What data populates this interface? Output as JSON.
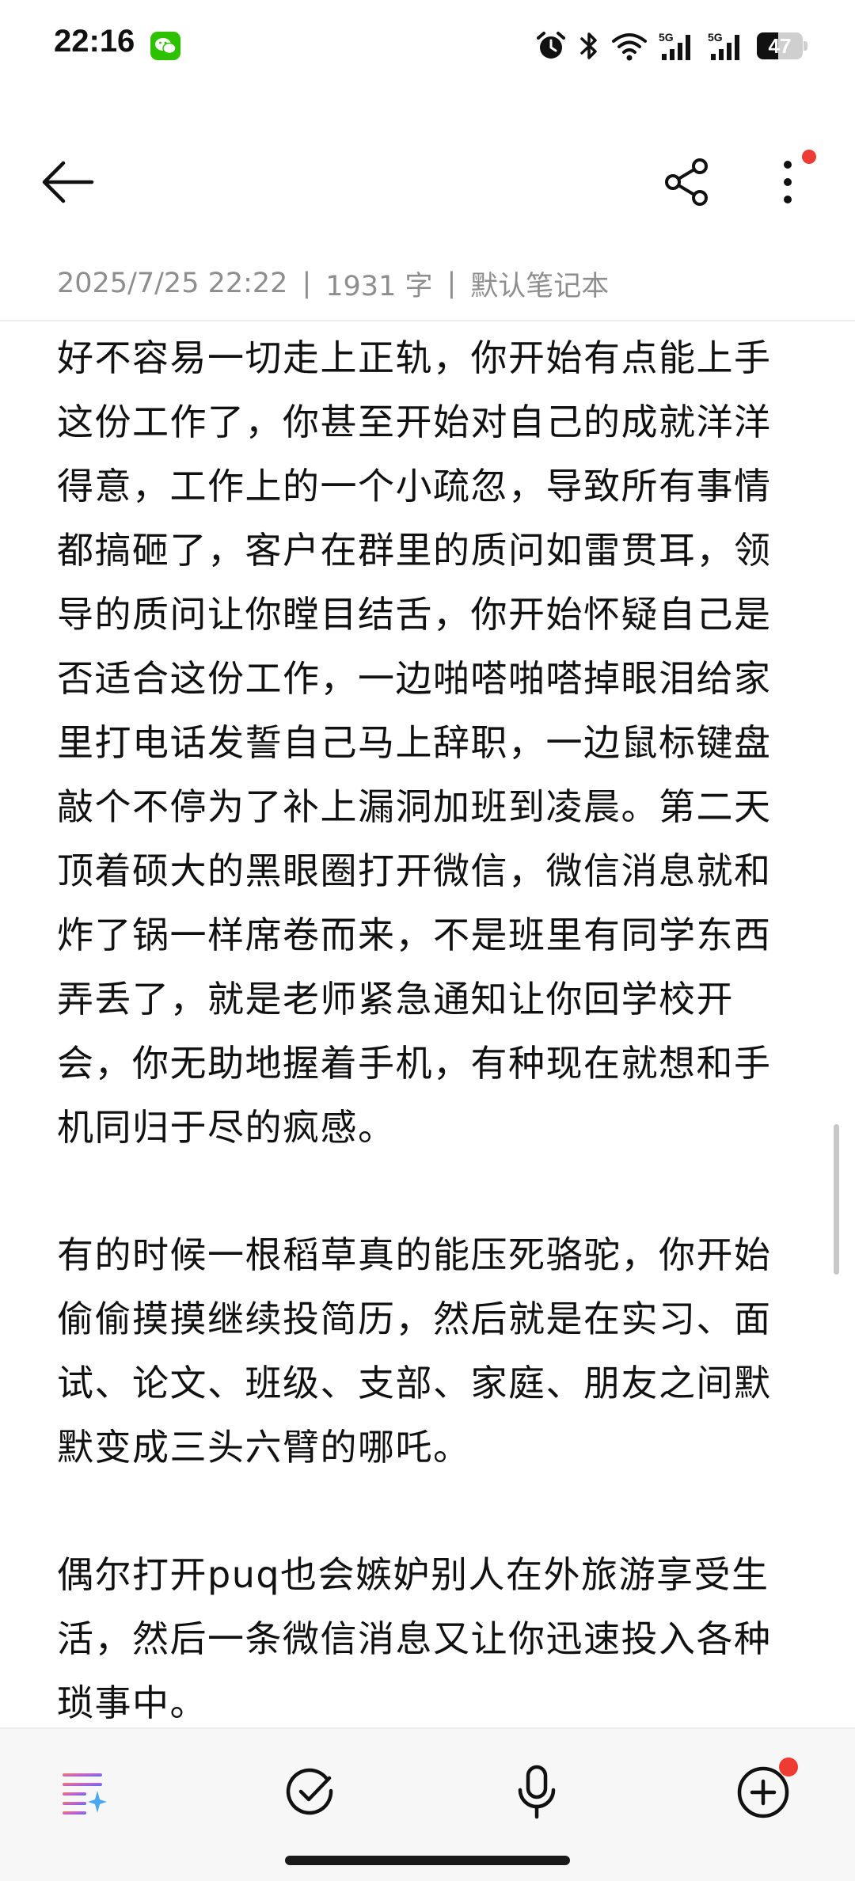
{
  "status_bar": {
    "time": "22:16",
    "battery": "47",
    "battery_level": 0.47,
    "network_label_1": "5G",
    "network_label_2": "5G"
  },
  "toolbar": {
    "back_icon": "arrow-left-icon",
    "share_icon": "share-icon",
    "more_icon": "more-vertical-icon"
  },
  "meta": {
    "date": "2025/7/25 22:22",
    "separator": "|",
    "word_count": "1931 字",
    "notebook": "默认笔记本"
  },
  "note": {
    "paragraphs": [
      "好不容易一切走上正轨，你开始有点能上手这份工作了，你甚至开始对自己的成就洋洋得意，工作上的一个小疏忽，导致所有事情都搞砸了，客户在群里的质问如雷贯耳，领导的质问让你瞠目结舌，你开始怀疑自己是否适合这份工作，一边啪嗒啪嗒掉眼泪给家里打电话发誓自己马上辞职，一边鼠标键盘敲个不停为了补上漏洞加班到凌晨。第二天顶着硕大的黑眼圈打开微信，微信消息就和炸了锅一样席卷而来，不是班里有同学东西弄丢了，就是老师紧急通知让你回学校开会，你无助地握着手机，有种现在就想和手机同归于尽的疯感。",
      "有的时候一根稻草真的能压死骆驼，你开始偷偷摸摸继续投简历，然后就是在实习、面试、论文、班级、支部、家庭、朋友之间默默变成三头六臂的哪吒。",
      "偶尔打开puq也会嫉妒别人在外旅游享受生活，然后一条微信消息又让你迅速投入各种琐事中。"
    ]
  },
  "bottom_bar": {
    "icons": [
      "ai-list-icon",
      "check-circle-icon",
      "microphone-icon",
      "add-circle-icon"
    ]
  },
  "colors": {
    "accent_red": "#ee3b33",
    "meta_gray": "#8e8e8e",
    "text": "#111111",
    "bottom_bg": "#f7f7f7"
  }
}
